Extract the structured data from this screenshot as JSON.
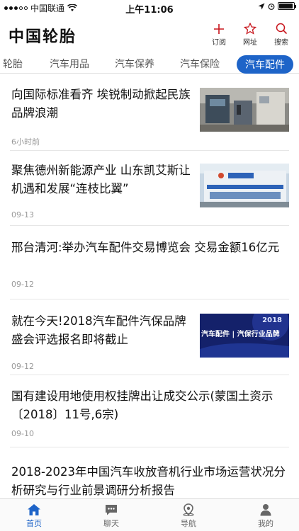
{
  "status_bar": {
    "carrier": "中国联通",
    "time": "上午11:06"
  },
  "header": {
    "brand": "中国轮胎",
    "actions": [
      {
        "label": "订阅",
        "icon": "plus-icon"
      },
      {
        "label": "网址",
        "icon": "star-icon"
      },
      {
        "label": "搜索",
        "icon": "search-icon"
      }
    ],
    "accent_color": "#c8161d"
  },
  "tabs": [
    {
      "label": "轮胎"
    },
    {
      "label": "汽车用品"
    },
    {
      "label": "汽车保养"
    },
    {
      "label": "汽车保险"
    },
    {
      "label": "汽车配件",
      "active": true
    }
  ],
  "tab_active_color": "#1e64c8",
  "news": [
    {
      "title": "向国际标准看齐 埃锐制动掀起民族品牌浪潮",
      "meta": "6小时前",
      "thumb": "workshop-photo"
    },
    {
      "title": "聚焦德州新能源产业 山东凯艾斯让机遇和发展“连枝比翼”",
      "meta": "09-13",
      "thumb": "factory-building-photo"
    },
    {
      "title": "邢台清河:举办汽车配件交易博览会 交易金额16亿元",
      "meta": "09-12"
    },
    {
      "title": "就在今天!2018汽车配件汽保品牌盛会评选报名即将截止",
      "meta": "09-12",
      "thumb": "event-banner-image",
      "thumb_text": "汽车配件 | 汽保行业品牌",
      "thumb_year": "2018"
    },
    {
      "title": "国有建设用地使用权挂牌出让成交公示(蒙国土资示〔2018〕11号,6宗)",
      "meta": "09-10"
    },
    {
      "title": "2018-2023年中国汽车收放音机行业市场运营状况分析研究与行业前景调研分析报告",
      "meta": ""
    }
  ],
  "tabbar": [
    {
      "label": "首页",
      "icon": "home-icon",
      "active": true
    },
    {
      "label": "聊天",
      "icon": "chat-bubble-icon"
    },
    {
      "label": "导航",
      "icon": "navigation-pin-icon"
    },
    {
      "label": "我的",
      "icon": "user-icon"
    }
  ]
}
